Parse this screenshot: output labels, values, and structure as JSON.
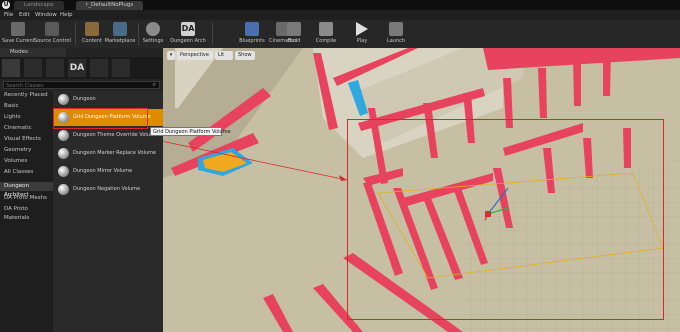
{
  "titlebar": {
    "tabs": [
      "Landscape",
      "r_DefaultNoPlugs"
    ]
  },
  "menubar": {
    "items": [
      "File",
      "Edit",
      "Window",
      "Help"
    ]
  },
  "toolbar": {
    "buttons": [
      {
        "label": "Save Current",
        "icon": "save-icon",
        "color": "#6a6a6a"
      },
      {
        "label": "Source Control",
        "icon": "source-control-icon",
        "color": "#5a5a5a"
      },
      {
        "label": "Content",
        "icon": "content-icon",
        "color": "#8a6a3a"
      },
      {
        "label": "Marketplace",
        "icon": "marketplace-icon",
        "color": "#4a6a8a"
      },
      {
        "label": "Settings",
        "icon": "gear-icon",
        "color": "#8a8a8a"
      },
      {
        "label": "Dungeon Arch",
        "icon": "dungeon-arch-icon",
        "color": "#d0d0d0"
      },
      {
        "label": "Blueprints",
        "icon": "blueprints-icon",
        "color": "#4a6fb0"
      },
      {
        "label": "Cinematics",
        "icon": "cinematics-icon",
        "color": "#6a6a6a"
      },
      {
        "label": "Build",
        "icon": "build-icon",
        "color": "#7a7a7a"
      },
      {
        "label": "Compile",
        "icon": "compile-icon",
        "color": "#8a8a8a"
      },
      {
        "label": "Play",
        "icon": "play-icon",
        "color": "#e0e0e0"
      },
      {
        "label": "Launch",
        "icon": "launch-icon",
        "color": "#7a7a7a"
      }
    ]
  },
  "modes": {
    "title": "Modes",
    "search_placeholder": "Search Classes",
    "categories": [
      "Recently Placed",
      "Basic",
      "Lights",
      "Cinematic",
      "Visual Effects",
      "Geometry",
      "Volumes",
      "All Classes",
      "Dungeon Architect",
      "DA Proto Meshs",
      "DA Proto Materials"
    ],
    "active_category": "Dungeon Architect",
    "items": [
      "Dungeon",
      "Grid Dungeon Platform Volume",
      "Dungeon Theme Override Volume",
      "Dungeon Marker Replace Volume",
      "Dungeon Mirror Volume",
      "Dungeon Negation Volume"
    ],
    "selected_item": "Grid Dungeon Platform Volume",
    "tooltip": "Grid Dungeon Platform Volume"
  },
  "viewport": {
    "view_mode": "Perspective",
    "lit_mode": "Lit",
    "show_label": "Show",
    "colors": {
      "floor": "#c7bfa4",
      "pillar": "#e8435e",
      "accent": "#d52a2a",
      "highlight": "#f0a81e",
      "cyan": "#2fa8e0"
    }
  }
}
